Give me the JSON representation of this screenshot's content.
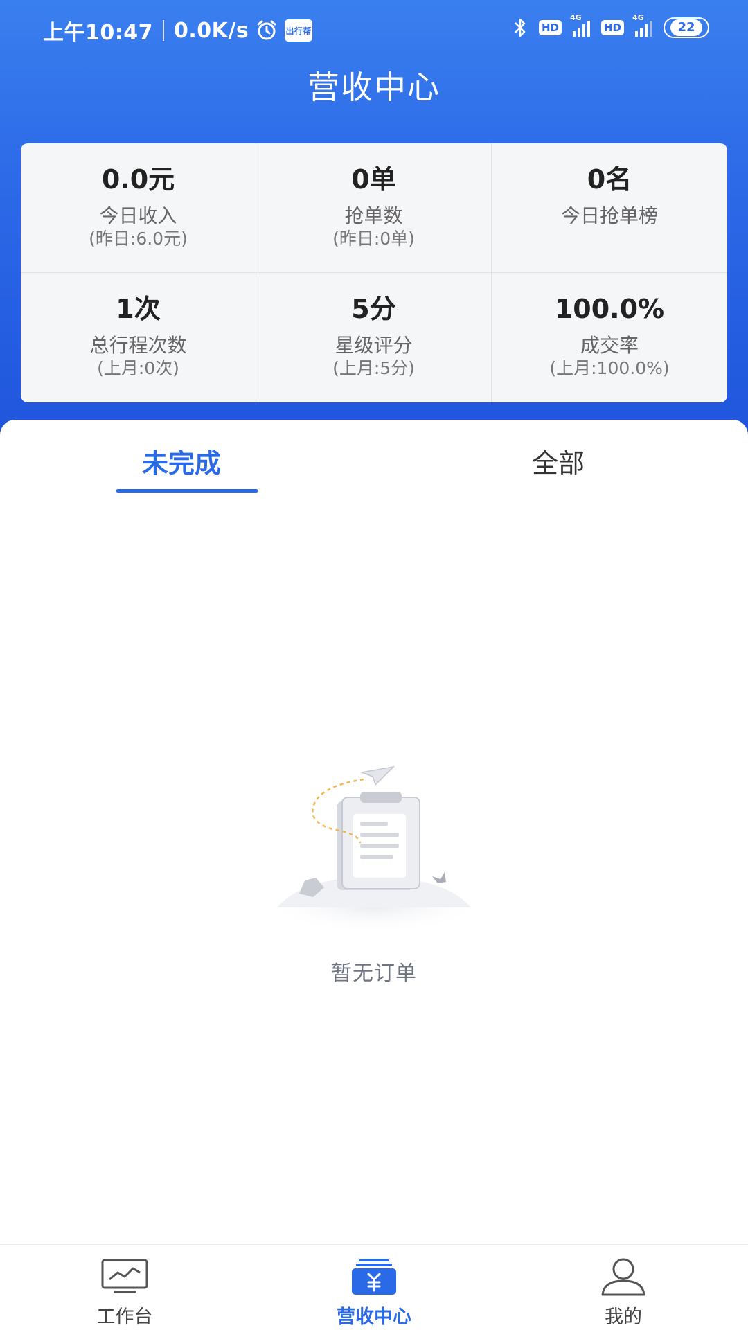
{
  "status_bar": {
    "time": "上午10:47",
    "speed": "0.0K/s",
    "app_badge": "出行帮",
    "hd": "HD",
    "net": "4G",
    "battery": "22"
  },
  "header": {
    "title": "营收中心"
  },
  "stats": [
    {
      "value": "0.0元",
      "label": "今日收入",
      "sub": "(昨日:6.0元)"
    },
    {
      "value": "0单",
      "label": "抢单数",
      "sub": "(昨日:0单)"
    },
    {
      "value": "0名",
      "label": "今日抢单榜",
      "sub": ""
    },
    {
      "value": "1次",
      "label": "总行程次数",
      "sub": "(上月:0次)"
    },
    {
      "value": "5分",
      "label": "星级评分",
      "sub": "(上月:5分)"
    },
    {
      "value": "100.0%",
      "label": "成交率",
      "sub": "(上月:100.0%)"
    }
  ],
  "tabs": [
    {
      "label": "未完成",
      "active": true
    },
    {
      "label": "全部",
      "active": false
    }
  ],
  "empty": {
    "text": "暂无订单"
  },
  "nav": [
    {
      "label": "工作台",
      "icon": "monitor-chart-icon"
    },
    {
      "label": "营收中心",
      "icon": "yuan-wallet-icon"
    },
    {
      "label": "我的",
      "icon": "user-icon"
    }
  ],
  "colors": {
    "primary": "#2b6ae6",
    "header_top": "#3a7fef",
    "header_bottom": "#1f55dc"
  }
}
